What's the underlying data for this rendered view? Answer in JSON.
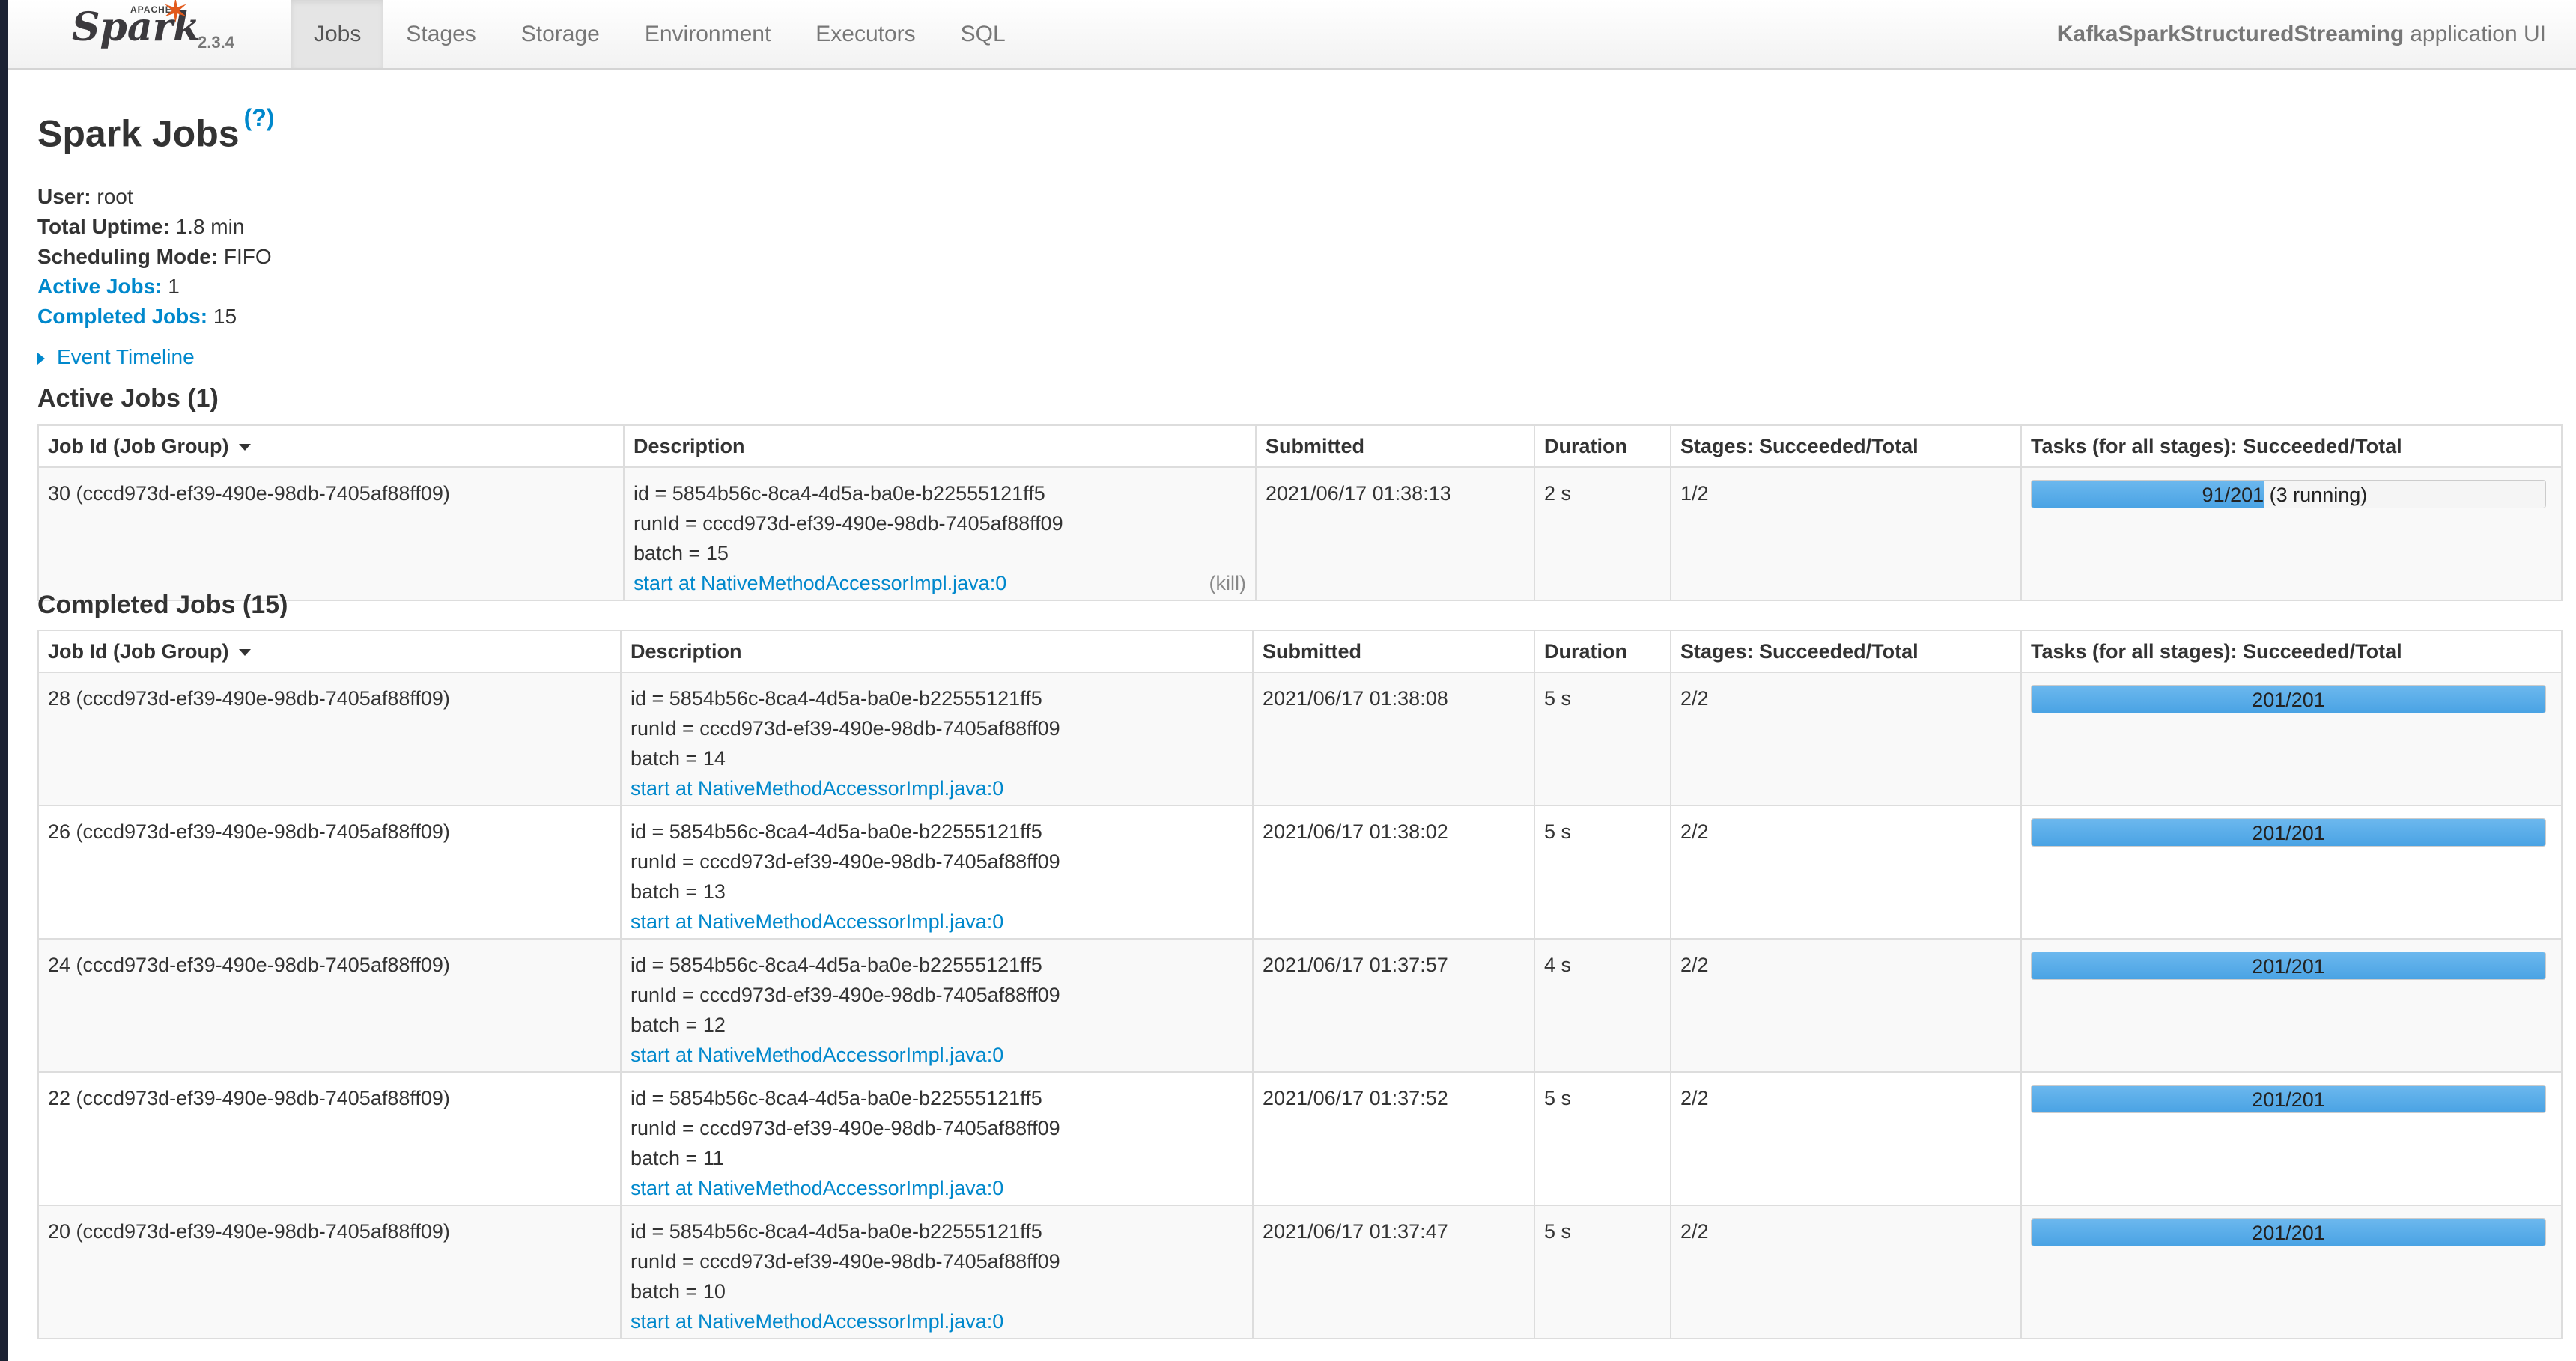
{
  "navbar": {
    "brand": {
      "apache": "APACHE",
      "name": "Spark",
      "version": "2.3.4"
    },
    "tabs": [
      {
        "label": "Jobs",
        "active": true
      },
      {
        "label": "Stages",
        "active": false
      },
      {
        "label": "Storage",
        "active": false
      },
      {
        "label": "Environment",
        "active": false
      },
      {
        "label": "Executors",
        "active": false
      },
      {
        "label": "SQL",
        "active": false
      }
    ],
    "app_name": "KafkaSparkStructuredStreaming",
    "app_suffix": "application UI"
  },
  "page": {
    "title": "Spark Jobs",
    "help": "(?)",
    "summary": {
      "user_label": "User:",
      "user": "root",
      "uptime_label": "Total Uptime:",
      "uptime": "1.8 min",
      "mode_label": "Scheduling Mode:",
      "mode": "FIFO",
      "active_label": "Active Jobs:",
      "active": "1",
      "completed_label": "Completed Jobs:",
      "completed": "15"
    },
    "event_timeline": "Event Timeline"
  },
  "columns": [
    "Job Id (Job Group)",
    "Description",
    "Submitted",
    "Duration",
    "Stages: Succeeded/Total",
    "Tasks (for all stages): Succeeded/Total"
  ],
  "active_jobs": {
    "heading": "Active Jobs (1)",
    "rows": [
      {
        "job_id": "30 (cccd973d-ef39-490e-98db-7405af88ff09)",
        "desc_id": "id = 5854b56c-8ca4-4d5a-ba0e-b22555121ff5",
        "desc_runid": "runId = cccd973d-ef39-490e-98db-7405af88ff09",
        "desc_batch": "batch = 15",
        "desc_link": "start at NativeMethodAccessorImpl.java:0",
        "kill": "(kill)",
        "submitted": "2021/06/17 01:38:13",
        "duration": "2 s",
        "stages": "1/2",
        "tasks": "91/201",
        "tasks_fraction": 0.4527,
        "running": "(3 running)"
      }
    ]
  },
  "completed_jobs": {
    "heading": "Completed Jobs (15)",
    "rows": [
      {
        "job_id": "28 (cccd973d-ef39-490e-98db-7405af88ff09)",
        "desc_id": "id = 5854b56c-8ca4-4d5a-ba0e-b22555121ff5",
        "desc_runid": "runId = cccd973d-ef39-490e-98db-7405af88ff09",
        "desc_batch": "batch = 14",
        "desc_link": "start at NativeMethodAccessorImpl.java:0",
        "submitted": "2021/06/17 01:38:08",
        "duration": "5 s",
        "stages": "2/2",
        "tasks": "201/201",
        "tasks_fraction": 1.0
      },
      {
        "job_id": "26 (cccd973d-ef39-490e-98db-7405af88ff09)",
        "desc_id": "id = 5854b56c-8ca4-4d5a-ba0e-b22555121ff5",
        "desc_runid": "runId = cccd973d-ef39-490e-98db-7405af88ff09",
        "desc_batch": "batch = 13",
        "desc_link": "start at NativeMethodAccessorImpl.java:0",
        "submitted": "2021/06/17 01:38:02",
        "duration": "5 s",
        "stages": "2/2",
        "tasks": "201/201",
        "tasks_fraction": 1.0
      },
      {
        "job_id": "24 (cccd973d-ef39-490e-98db-7405af88ff09)",
        "desc_id": "id = 5854b56c-8ca4-4d5a-ba0e-b22555121ff5",
        "desc_runid": "runId = cccd973d-ef39-490e-98db-7405af88ff09",
        "desc_batch": "batch = 12",
        "desc_link": "start at NativeMethodAccessorImpl.java:0",
        "submitted": "2021/06/17 01:37:57",
        "duration": "4 s",
        "stages": "2/2",
        "tasks": "201/201",
        "tasks_fraction": 1.0
      },
      {
        "job_id": "22 (cccd973d-ef39-490e-98db-7405af88ff09)",
        "desc_id": "id = 5854b56c-8ca4-4d5a-ba0e-b22555121ff5",
        "desc_runid": "runId = cccd973d-ef39-490e-98db-7405af88ff09",
        "desc_batch": "batch = 11",
        "desc_link": "start at NativeMethodAccessorImpl.java:0",
        "submitted": "2021/06/17 01:37:52",
        "duration": "5 s",
        "stages": "2/2",
        "tasks": "201/201",
        "tasks_fraction": 1.0
      },
      {
        "job_id": "20 (cccd973d-ef39-490e-98db-7405af88ff09)",
        "desc_id": "id = 5854b56c-8ca4-4d5a-ba0e-b22555121ff5",
        "desc_runid": "runId = cccd973d-ef39-490e-98db-7405af88ff09",
        "desc_batch": "batch = 10",
        "desc_link": "start at NativeMethodAccessorImpl.java:0",
        "submitted": "2021/06/17 01:37:47",
        "duration": "5 s",
        "stages": "2/2",
        "tasks": "201/201",
        "tasks_fraction": 1.0
      }
    ]
  },
  "colors": {
    "link": "#0088cc",
    "progress": "#4aa3e4",
    "brand_star": "#e25a1c"
  }
}
